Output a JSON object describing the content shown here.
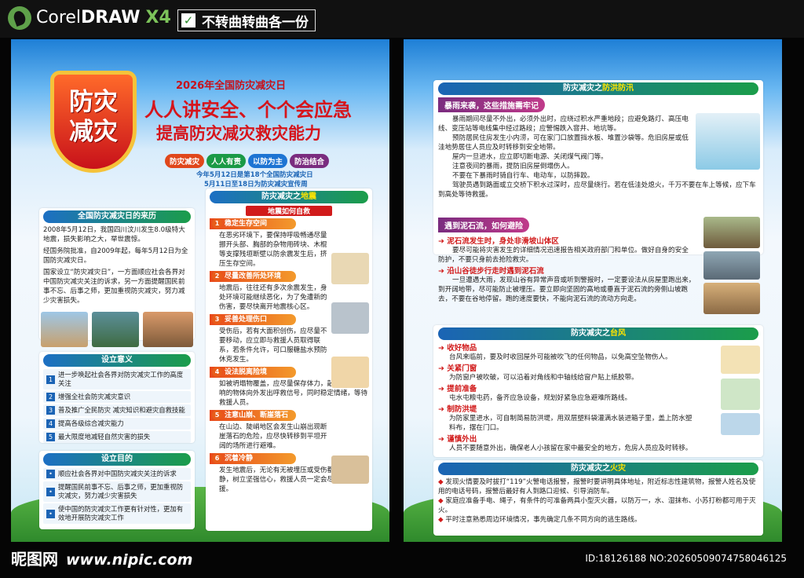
{
  "header": {
    "app_name_a": "Corel",
    "app_name_b": "DRAW",
    "app_version": "X4",
    "note": "不转曲转曲各一份"
  },
  "left": {
    "badge_l1": "防灾",
    "badge_l2": "减灾",
    "year_title": "2026年全国防灾减灾日",
    "slogan1": "人人讲安全、个个会应急",
    "slogan2": "提高防灾减灾救灾能力",
    "tags": [
      {
        "label": "防灾减灾",
        "color": "#e0471b"
      },
      {
        "label": "人人有责",
        "color": "#1a9a46"
      },
      {
        "label": "以防为主",
        "color": "#1d74d3"
      },
      {
        "label": "防治结合",
        "color": "#7a2c7f"
      }
    ],
    "date_line1": "今年5月12日是第18个全国防灾减灾日",
    "date_line2": "5月11日至18日为防灾减灾宣传周",
    "origin": {
      "title": "全国防灾减灾日的来历",
      "p1": "2008年5月12日，我国四川汶川发生8.0级特大地震，损失影响之大，举世震惊。",
      "p2": "经国务院批准，自2009年起，每年5月12日为全国防灾减灾日。",
      "p3": "国家设立“防灾减灾日”，一方面顺应社会各界对中国防灾减灾关注的诉求，另一方面提醒国民前事不忘、后事之师，更加重视防灾减灾，努力减少灾害损失。"
    },
    "meaning": {
      "title": "设立意义",
      "items": [
        "进一步唤起社会各界对防灾减灾工作的高度关注",
        "增强全社会防灾减灾意识",
        "普及推广全民防灾 减灾知识和避灾自救技能",
        "提高各级综合减灾能力",
        "最大限度地减轻自然灾害的损失"
      ]
    },
    "purpose": {
      "title": "设立目的",
      "items": [
        "顺应社会各界对中国防灾减灾关注的诉求",
        "提醒国民前事不忘、后事之师，更加重视防灾减灾，努力减少灾害损失",
        "使中国的防灾减灾工作更有针对性，更加有效地开展防灾减灾工作"
      ]
    },
    "quake": {
      "title_a": "防灾减灾之",
      "title_b": "地震",
      "sub": "地震如何自救",
      "steps": [
        {
          "n": "1",
          "t": "稳定生存空间",
          "d": "在恶劣环境下，要保持呼吸畅通尽量挪开头部、胸部的杂物用砖块、木棍等支撑残垣断壁以防余震发生后，挤压生存空间。"
        },
        {
          "n": "2",
          "t": "尽量改善所处环境",
          "d": "地震后，往往还有多次余震发生，身处环境可能继续恶化，为了免遭新的伤害，要尽快离开地震核心区。"
        },
        {
          "n": "3",
          "t": "妥善处理伤口",
          "d": "受伤后，若有大面积创伤，应尽量不要移动，应立即与救援人员取得联系，若条件允许，可口服糖盐水预防休克发生。"
        },
        {
          "n": "4",
          "t": "设法脱离险境",
          "d": "如被坍塌物覆盖，应尽量保存体力，敲击能发出声响的物体向外发出呼救信号，同时稳定情绪，等待救援人员。"
        },
        {
          "n": "5",
          "t": "注意山崩、断崖落石",
          "d": "在山边、陡峭地区会发生山崩出现断崖落石的危险，应尽快转移到平坦开阔的场所进行避难。"
        },
        {
          "n": "6",
          "t": "沉着冷静",
          "d": "发生地震后，无论有无被埋压或受伤都要沉着冷静，树立坚强信心，救援人员一定会尽快到达救援。"
        }
      ]
    }
  },
  "right": {
    "flood": {
      "title_a": "防灾减灾之",
      "title_b": "防洪防汛",
      "phase": "暴雨来袭，这些措施需牢记",
      "paras": [
        "暴雨期间尽量不外出，必须外出时，应绕过积水严重地段；应避免路灯、高压电线、变压站等电线集中经过路段；应警惕跌入窨井、地坑等。",
        "预防居民住房发生小内涝，可在家门口放置挡水板、堆置沙袋等。危旧房屋或低洼地势居住人员应及时转移到安全地带。",
        "屋内一旦进水，应立即切断电源、关闭煤气阀门等。",
        "注意夜间的暴雨，提防旧房屋倒塌伤人。",
        "不要在下暴雨时骑自行车、电动车，以防摔跤。",
        "驾驶员遇到路面或立交桥下积水过深时，应尽量绕行。若在低洼处熄火，千万不要在车上等候，应下车到高处等待救援。"
      ]
    },
    "mud": {
      "phase": "遇到泥石流，如何避险",
      "s1": "泥石流发生时，身处非滑坡山体区",
      "d1": "要尽可能将灾害发生的详细情况迅速报告相关政府部门和单位。做好自身的安全防护，不要只身前去抢险救灾。",
      "s2": "沿山谷徒步行走时遇到泥石流",
      "d2": "一旦遭遇大雨，发现山谷有异常声音或听到警报时，一定要设法从房屋里跑出来，到开阔地带，尽可能防止被埋压。要立即向坚固的高地或垂直于泥石流的旁侧山坡跑去，不要在谷地停留。跑的速度要快，不能向泥石流的流动方向走。"
    },
    "typhoon": {
      "title_a": "防灾减灾之",
      "title_b": "台风",
      "items": [
        {
          "t": "收好物品",
          "d": "台风来临前，要及时收回屋外可能被吹飞的任何物品，以免高空坠物伤人。"
        },
        {
          "t": "关紧门窗",
          "d": "为防窗户被吹破，可以沿着对角线和中轴线给窗户贴上纸胶带。"
        },
        {
          "t": "提前准备",
          "d": "屯水屯粮屯药，备齐应急设备，规划好紧急应急避难所路线。"
        },
        {
          "t": "制防洪堤",
          "d": "为防家里进水，可自制简易防洪堤，用双层塑料袋灌满水装进箱子里，盖上防水塑料布，摆在门口。"
        },
        {
          "t": "谨慎外出",
          "d": "人员不要随意外出，确保老人小孩留在家中最安全的地方，危房人员应及时转移。"
        }
      ]
    },
    "fire": {
      "title_a": "防灾减灾之",
      "title_b": "火灾",
      "items": [
        "发现火情要及时拔打“119”火警电话报警，报警时要讲明具体地址，附近标志性建筑物，报警人姓名及使用的电话号码，报警后最好有人到路口迎候、引导消防车。",
        "家庭应准备手电、绳子，有条件的可准备两具小型灭火器，以防万一，水、湿抹布、小苏打粉都可用于灭火。",
        "平时注意熟悉周边环境情况，事先确定几条不同方向的逃生路线。"
      ]
    }
  },
  "footer": {
    "site": "昵图网",
    "url": "www.nipic.com",
    "id_line": "ID:18126188 NO:20260509074758046125"
  }
}
